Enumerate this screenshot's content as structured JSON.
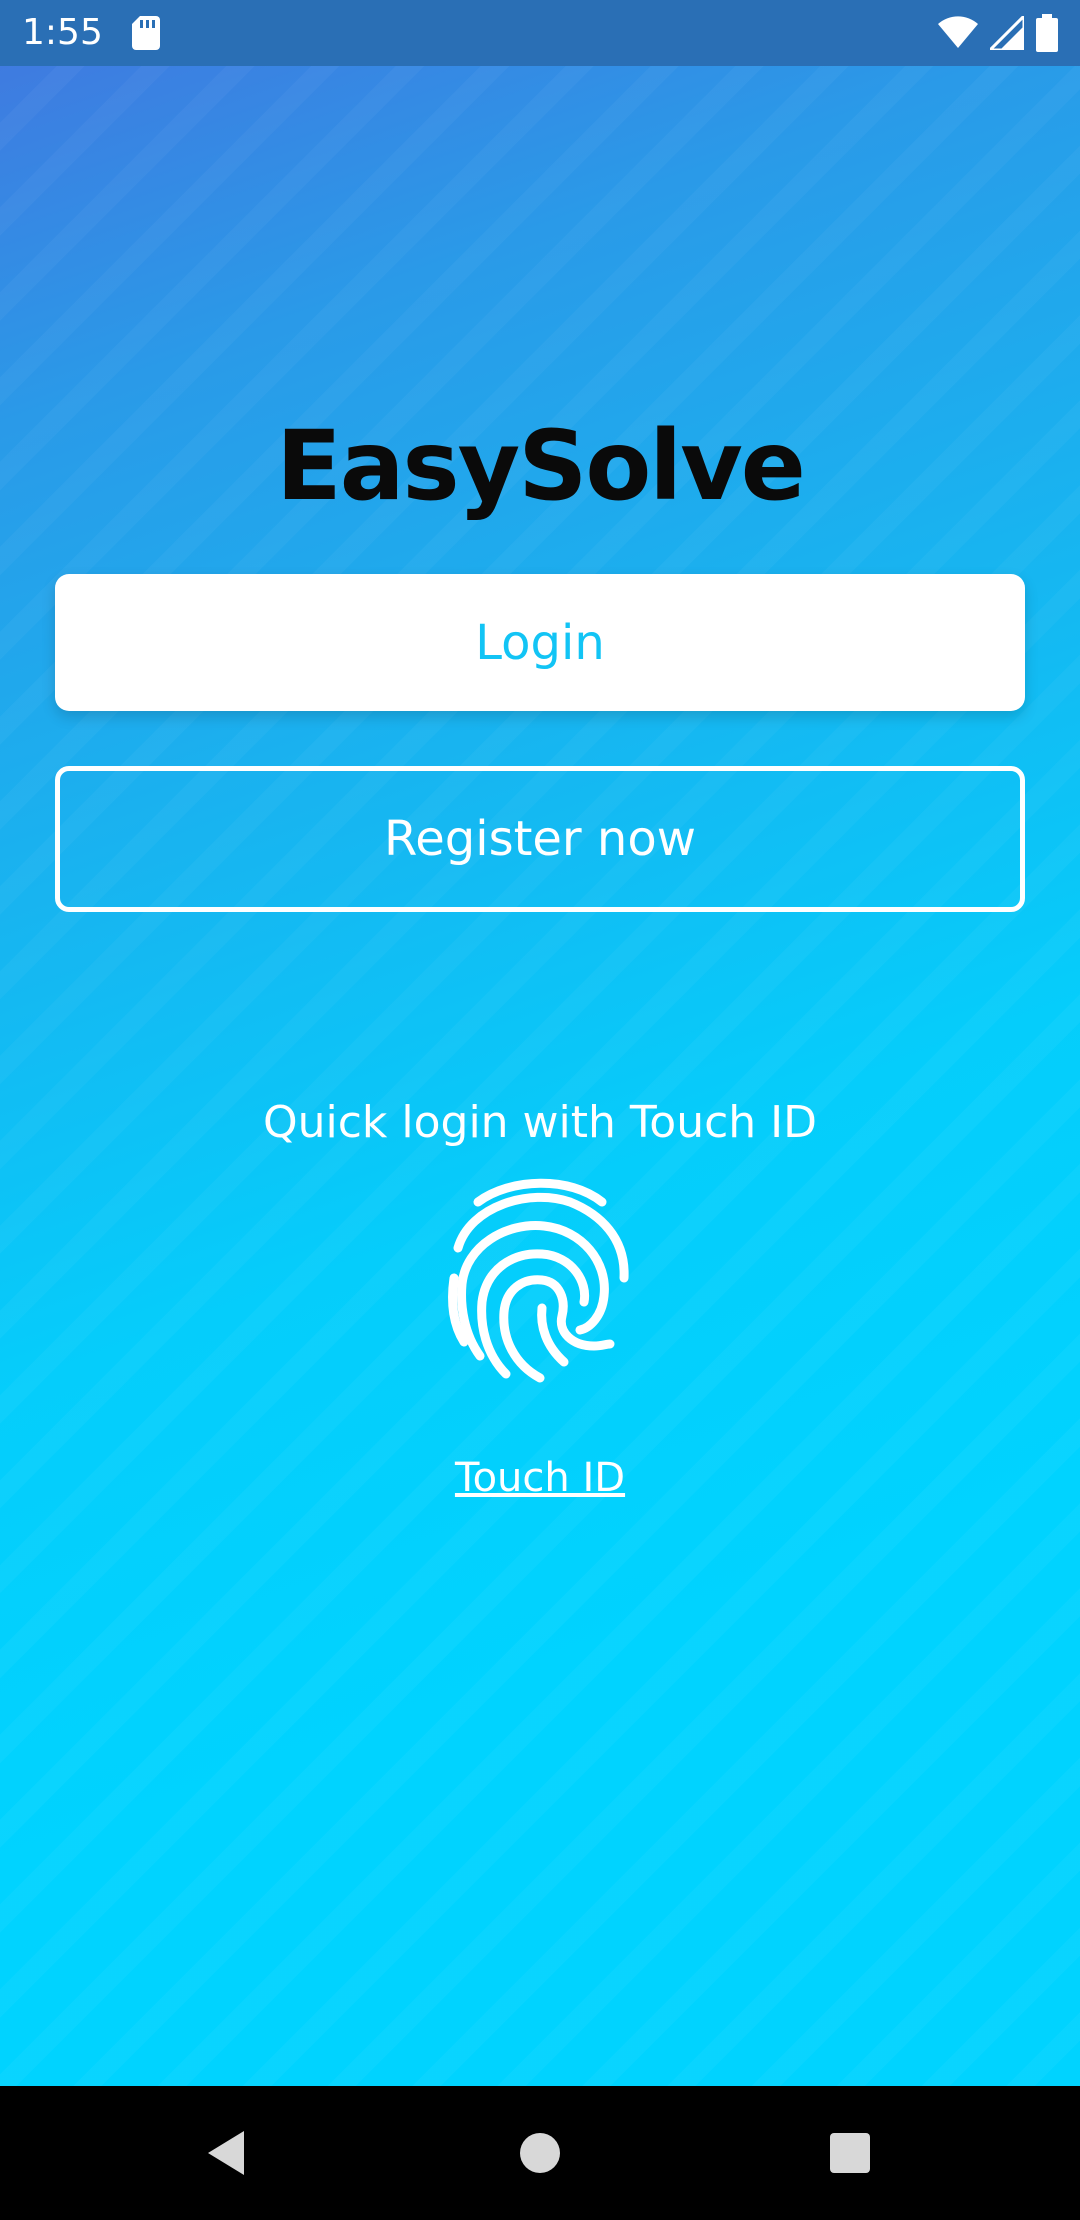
{
  "status_bar": {
    "time": "1:55",
    "icons": [
      "sd-card-icon",
      "wifi-icon",
      "signal-icon",
      "battery-icon"
    ]
  },
  "app": {
    "title": "EasySolve",
    "login_label": "Login",
    "register_label": "Register now",
    "quick_login_text": "Quick login with Touch ID",
    "touch_id_link": "Touch ID",
    "fingerprint_icon": "fingerprint-icon"
  },
  "colors": {
    "gradient_top": "#3f7be0",
    "gradient_bottom": "#00d3ff",
    "login_text": "#12c4f5",
    "title": "#0a0a0a"
  },
  "nav_bar": {
    "icons": [
      "back-icon",
      "home-icon",
      "recents-icon"
    ]
  }
}
